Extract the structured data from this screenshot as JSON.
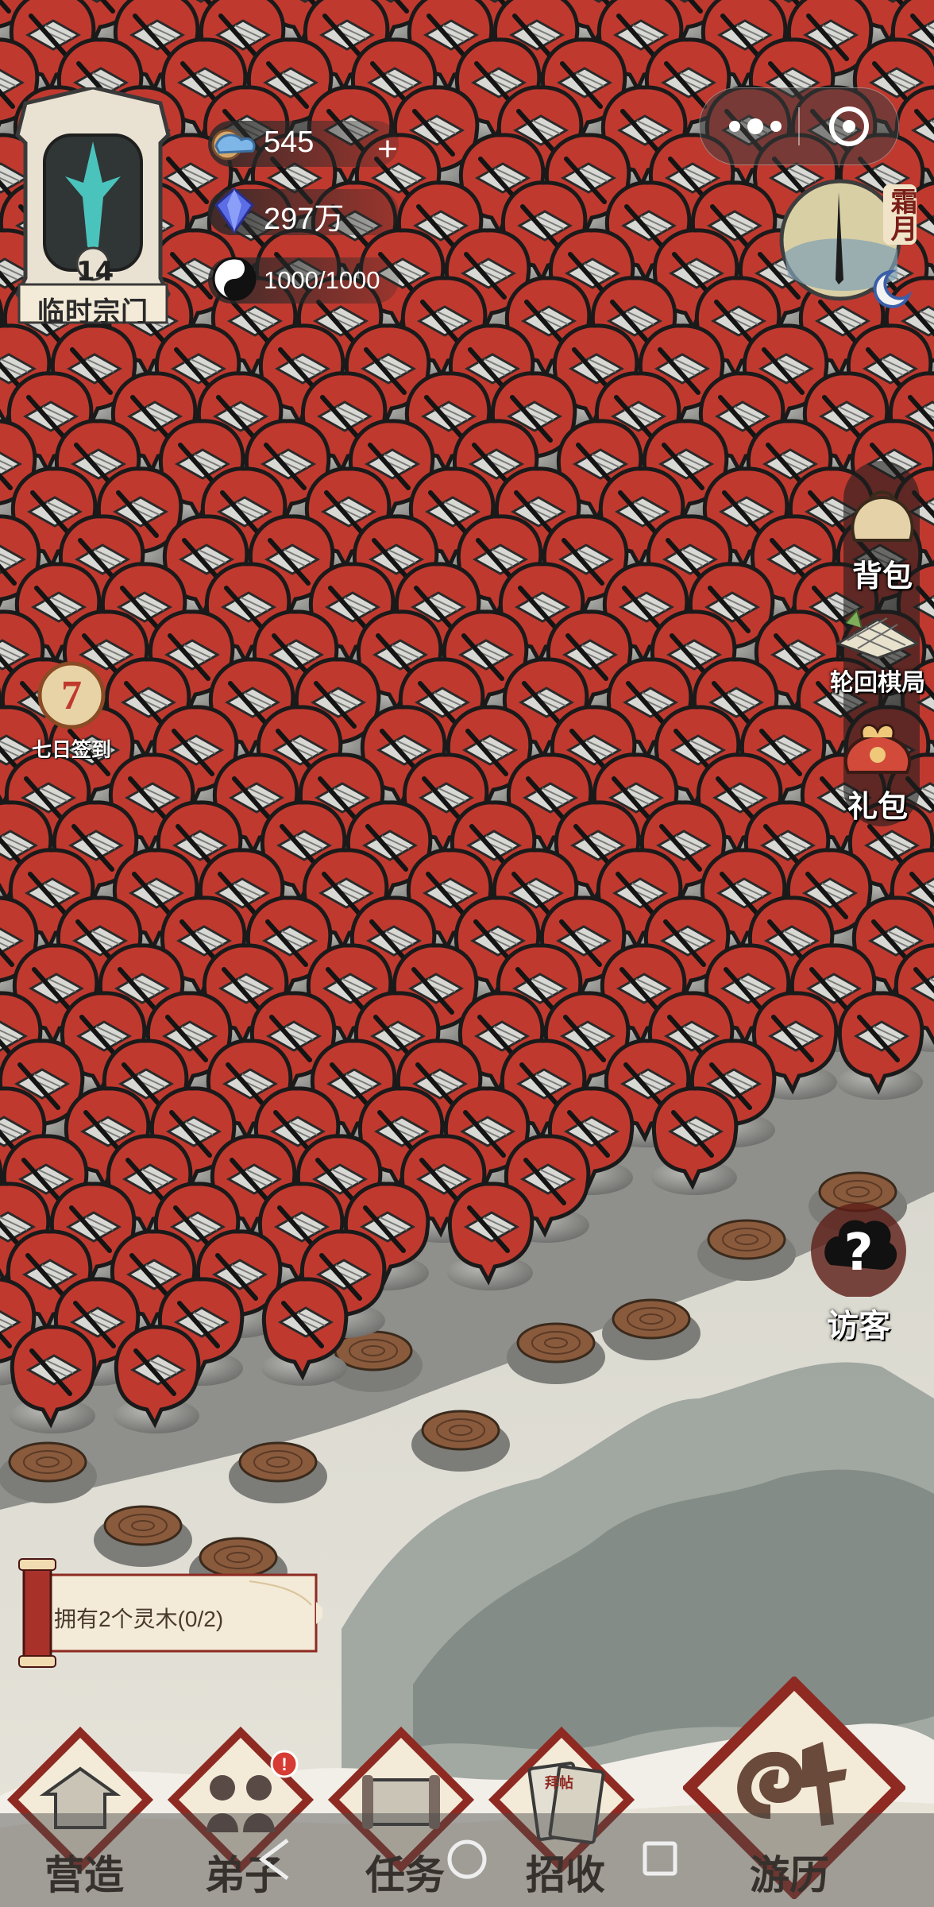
{
  "sect": {
    "level": "14",
    "name": "临时宗门"
  },
  "resources": {
    "spirit_stone": {
      "value": "545",
      "icon": "cloud-coin-icon"
    },
    "crystal": {
      "value": "297万",
      "icon": "blue-gem-icon"
    },
    "stamina": {
      "value": "1000/1000",
      "icon": "yin-yang-icon"
    },
    "plus_label": "+"
  },
  "clock": {
    "season_label": "霜月"
  },
  "side_menu": {
    "bag": "背包",
    "chess": "轮回棋局",
    "gift": "礼包"
  },
  "checkin": {
    "day": "7",
    "label": "七日签到"
  },
  "visitor": {
    "label": "访客"
  },
  "quest": {
    "text": "拥有2个灵木(0/2)"
  },
  "nav": {
    "build": "营造",
    "disciples": "弟子",
    "tasks": "任务",
    "recruit": "招收",
    "recruit_card": "拜帖",
    "travel": "游历"
  },
  "colors": {
    "blocked_red": "#c0392f",
    "paper": "#f3ead7",
    "frame_red": "#8e2a22"
  }
}
